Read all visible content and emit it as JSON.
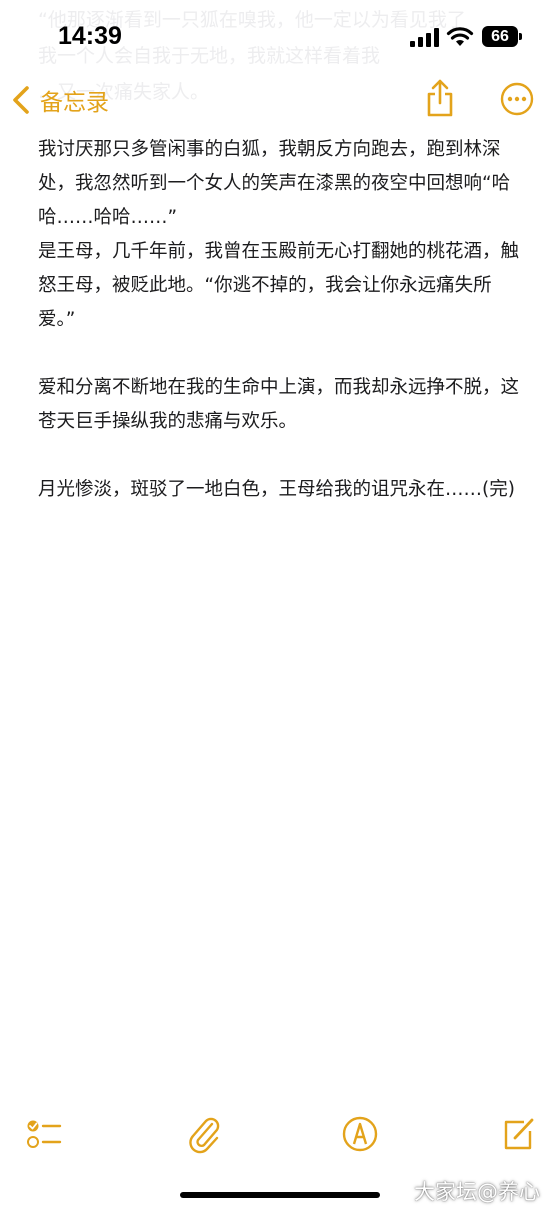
{
  "status_bar": {
    "time": "14:39",
    "battery": "66",
    "icons": [
      "cellular-signal-icon",
      "wifi-icon",
      "battery-icon"
    ]
  },
  "ghost_text": "“他那逐渐看到一只狐在嗅我，他一定以为看见我了\n我一个人会自我于无地，我就这样看着我\n…又一次痛失家人。",
  "nav": {
    "back_label": "备忘录",
    "icons": [
      "chevron-left-icon",
      "share-icon",
      "more-icon"
    ]
  },
  "note": {
    "paragraphs": [
      "我讨厌那只多管闲事的白狐，我朝反方向跑去，跑到林深处，我忽然听到一个女人的笑声在漆黑的夜空中回想响“哈哈……哈哈……”",
      "是王母，几千年前，我曾在玉殿前无心打翻她的桃花酒，触怒王母，被贬此地。“你逃不掉的，我会让你永远痛失所爱。”",
      "",
      "爱和分离不断地在我的生命中上演，而我却永远挣不脱，这苍天巨手操纵我的悲痛与欢乐。",
      "",
      "月光惨淡，斑驳了一地白色，王母给我的诅咒永在……(完)"
    ]
  },
  "toolbar": {
    "icons": [
      "checklist-icon",
      "paperclip-icon",
      "markup-pen-icon",
      "compose-icon"
    ]
  },
  "watermark": "大家坛@养心",
  "colors": {
    "accent": "#e3a31b",
    "text": "#1c1c1e",
    "background": "#ffffff"
  }
}
